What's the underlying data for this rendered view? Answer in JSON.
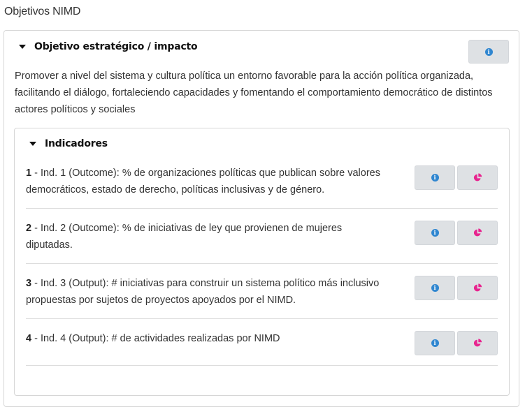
{
  "page": {
    "title": "Objetivos NIMD"
  },
  "objective": {
    "heading": "Objetivo estratégico / impacto",
    "info_icon": "info-circle-icon",
    "description": "Promover a nivel del sistema y cultura política un entorno favorable para la acción política organizada, facilitando el diálogo, fortaleciendo capacidades y fomentando el comportamiento democrático de distintos actores políticos y sociales"
  },
  "indicators": {
    "heading": "Indicadores",
    "items": [
      {
        "number": "1",
        "text": " - Ind. 1 (Outcome): % de organizaciones políticas que publican sobre valores democráticos, estado de derecho, políticas inclusivas y de género."
      },
      {
        "number": "2",
        "text": " - Ind. 2 (Outcome): % de iniciativas de ley que provienen de mujeres diputadas."
      },
      {
        "number": "3",
        "text": " - Ind. 3 (Output): # iniciativas para construir un sistema político más inclusivo propuestas por sujetos de proyectos apoyados por el NIMD."
      },
      {
        "number": "4",
        "text": " - Ind. 4 (Output): # de actividades realizadas por NIMD"
      }
    ],
    "icons": {
      "info": "info-circle-icon",
      "chart": "pie-chart-icon"
    }
  },
  "colors": {
    "info_icon": "#2f86d0",
    "chart_icon": "#e8248f",
    "button_bg": "#dee1e4",
    "border": "#d6d6d6"
  }
}
